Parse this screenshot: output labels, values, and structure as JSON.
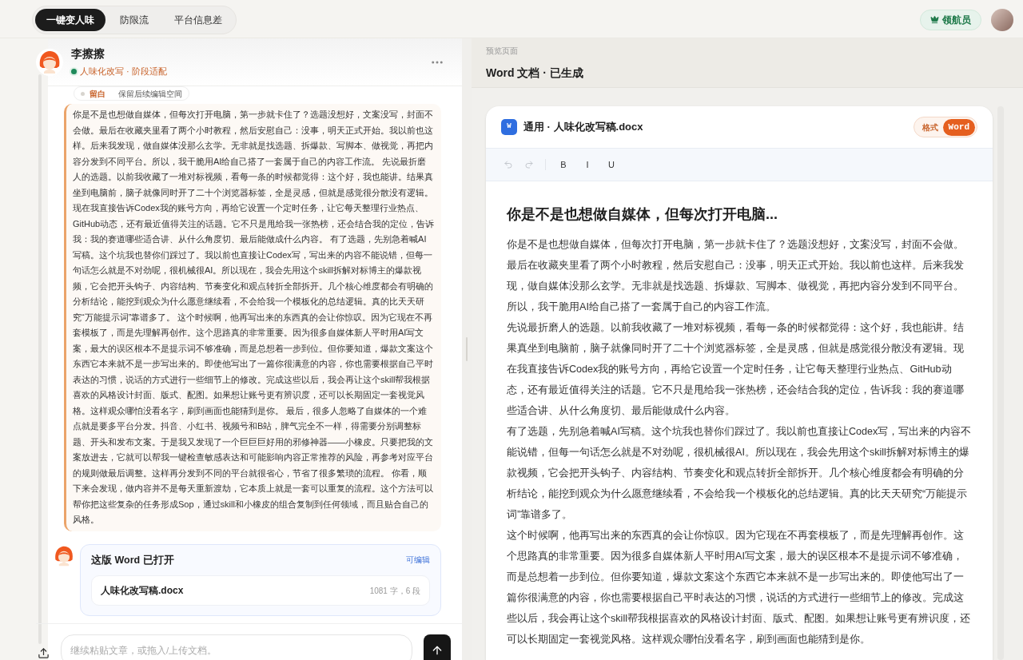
{
  "tabs": [
    {
      "label": "一键变人味",
      "selected": true
    },
    {
      "label": "防限流",
      "selected": false
    },
    {
      "label": "平台信息差",
      "selected": false
    }
  ],
  "user_badge": "领航员",
  "chat": {
    "header": {
      "name": "李擦擦",
      "status": "人味化改写 · 阶段适配",
      "online": true
    },
    "chip": {
      "label": "留白",
      "text": "保留后续编辑空间"
    },
    "message": "你是不是也想做自媒体，但每次打开电脑，第一步就卡住了？选题没想好，文案没写，封面不会做。最后在收藏夹里看了两个小时教程，然后安慰自己：没事，明天正式开始。我以前也这样。后来我发现，做自媒体没那么玄学。无非就是找选题、拆爆款、写脚本、做视觉，再把内容分发到不同平台。所以，我干脆用AI给自己搭了一套属于自己的内容工作流。 先说最折磨人的选题。以前我收藏了一堆对标视频，看每一条的时候都觉得：这个好，我也能讲。结果真坐到电脑前，脑子就像同时开了二十个浏览器标签，全是灵感，但就是感觉很分散没有逻辑。现在我直接告诉Codex我的账号方向，再给它设置一个定时任务，让它每天整理行业热点、GitHub动态，还有最近值得关注的话题。它不只是甩给我一张热榜，还会结合我的定位，告诉我：我的赛道哪些适合讲、从什么角度切、最后能做成什么内容。 有了选题，先别急着喊AI写稿。这个坑我也替你们踩过了。我以前也直接让Codex写，写出来的内容不能说错，但每一句话怎么就是不对劲呢，很机械很AI。所以现在，我会先用这个skill拆解对标博主的爆款视频，它会把开头钩子、内容结构、节奏变化和观点转折全部拆开。几个核心维度都会有明确的分析结论，能挖到观众为什么愿意继续看，不会给我一个模板化的总结逻辑。真的比天天研究“万能提示词”靠谱多了。 这个时候啊，他再写出来的东西真的会让你惊叹。因为它现在不再套模板了，而是先理解再创作。这个思路真的非常重要。因为很多自媒体新人平时用AI写文案，最大的误区根本不是提示词不够准确，而是总想着一步到位。但你要知道，爆款文案这个东西它本来就不是一步写出来的。即使他写出了一篇你很满意的内容，你也需要根据自己平时表达的习惯，说话的方式进行一些细节上的修改。完成这些以后，我会再让这个skill帮我根据喜欢的风格设计封面、版式、配图。如果想让账号更有辨识度，还可以长期固定一套视觉风格。这样观众哪怕没看名字，刷到画面也能猜到是你。 最后，很多人忽略了自媒体的一个难点就是要多平台分发。抖音、小红书、视频号和B站，脾气完全不一样，得需要分别调整标题、开头和发布文案。于是我又发现了一个巨巨巨好用的邪修神器——小橡皮。只要把我的文案放进去，它就可以帮我一键检查敏感表达和可能影响内容正常推荐的风险，再参考对应平台的规则做最后调整。这样再分发到不同的平台就很省心，节省了很多繁琐的流程。 你看，顺下来会发现，做内容并不是每天重新渡劫，它本质上就是一套可以重复的流程。这个方法可以帮你把这些复杂的任务形成Sop，通过skill和小橡皮的组合复制到任何领域，而且贴合自己的风格。",
    "word_card": {
      "title": "这版 Word 已打开",
      "action": "可编辑",
      "file": {
        "name": "人味化改写稿.docx",
        "meta": "1081 字，6 段"
      }
    },
    "composer": {
      "placeholder": "继续粘贴文章，或拖入/上传文档。"
    }
  },
  "preview": {
    "eyebrow": "预览页面",
    "title": "Word 文档 · 已生成",
    "doc": {
      "file_icon": "W",
      "filename": "通用 · 人味化改写稿.docx",
      "format_label": "格式",
      "formats": [
        {
          "label": "Word",
          "selected": true
        }
      ],
      "toolbar": [
        {
          "kind": "undo",
          "disabled": true
        },
        {
          "kind": "redo",
          "disabled": true
        },
        {
          "kind": "text",
          "label": "B",
          "disabled": false
        },
        {
          "kind": "text",
          "label": "I",
          "disabled": false
        },
        {
          "kind": "text",
          "label": "U",
          "disabled": false
        }
      ],
      "heading": "你是不是也想做自媒体，但每次打开电脑...",
      "paragraphs": [
        "你是不是也想做自媒体，但每次打开电脑，第一步就卡住了？选题没想好，文案没写，封面不会做。最后在收藏夹里看了两个小时教程，然后安慰自己：没事，明天正式开始。我以前也这样。后来我发现，做自媒体没那么玄学。无非就是找选题、拆爆款、写脚本、做视觉，再把内容分发到不同平台。所以，我干脆用AI给自己搭了一套属于自己的内容工作流。",
        "先说最折磨人的选题。以前我收藏了一堆对标视频，看每一条的时候都觉得：这个好，我也能讲。结果真坐到电脑前，脑子就像同时开了二十个浏览器标签，全是灵感，但就是感觉很分散没有逻辑。现在我直接告诉Codex我的账号方向，再给它设置一个定时任务，让它每天整理行业热点、GitHub动态，还有最近值得关注的话题。它不只是甩给我一张热榜，还会结合我的定位，告诉我：我的赛道哪些适合讲、从什么角度切、最后能做成什么内容。",
        "有了选题，先别急着喊AI写稿。这个坑我也替你们踩过了。我以前也直接让Codex写，写出来的内容不能说错，但每一句话怎么就是不对劲呢，很机械很AI。所以现在，我会先用这个skill拆解对标博主的爆款视频，它会把开头钩子、内容结构、节奏变化和观点转折全部拆开。几个核心维度都会有明确的分析结论，能挖到观众为什么愿意继续看，不会给我一个模板化的总结逻辑。真的比天天研究“万能提示词”靠谱多了。",
        "这个时候啊，他再写出来的东西真的会让你惊叹。因为它现在不再套模板了，而是先理解再创作。这个思路真的非常重要。因为很多自媒体新人平时用AI写文案，最大的误区根本不是提示词不够准确，而是总想着一步到位。但你要知道，爆款文案这个东西它本来就不是一步写出来的。即使他写出了一篇你很满意的内容，你也需要根据自己平时表达的习惯，说话的方式进行一些细节上的修改。完成这些以后，我会再让这个skill帮我根据喜欢的风格设计封面、版式、配图。如果想让账号更有辨识度，还可以长期固定一套视觉风格。这样观众哪怕没看名字，刷到画面也能猜到是你。"
      ]
    }
  }
}
